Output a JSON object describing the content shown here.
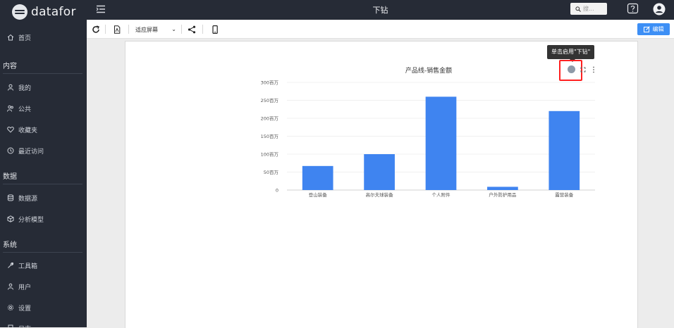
{
  "sidebar": {
    "logo": "datafor",
    "home": "首页",
    "sections": [
      {
        "title": "内容",
        "items": [
          "我的",
          "公共",
          "收藏夹",
          "最近访问"
        ]
      },
      {
        "title": "数据",
        "items": [
          "数据源",
          "分析模型"
        ]
      },
      {
        "title": "系统",
        "items": [
          "工具箱",
          "用户",
          "设置",
          "日志"
        ]
      }
    ]
  },
  "header": {
    "title": "下钻",
    "search_placeholder": "搜..."
  },
  "toolbar": {
    "fit_label": "适应屏幕",
    "edit_label": "编辑"
  },
  "tooltip": "单击启用\"下钻\"",
  "chart_data": {
    "type": "bar",
    "title": "产品线-销售金额",
    "categories": [
      "登山装备",
      "高尔夫球装备",
      "个人附件",
      "户外防护用品",
      "露营装备"
    ],
    "values": [
      67,
      100,
      260,
      9,
      220
    ],
    "unit_label": "百万",
    "ylim": [
      0,
      300
    ],
    "yticks": [
      "0",
      "50百万",
      "100百万",
      "150百万",
      "200百万",
      "250百万",
      "300百万"
    ],
    "grid": true,
    "color": "#3f84f0"
  },
  "colors": {
    "sidebar_bg": "#262b36",
    "accent": "#3d8ff5",
    "bar": "#3f84f0",
    "highlight": "#ff2020"
  }
}
